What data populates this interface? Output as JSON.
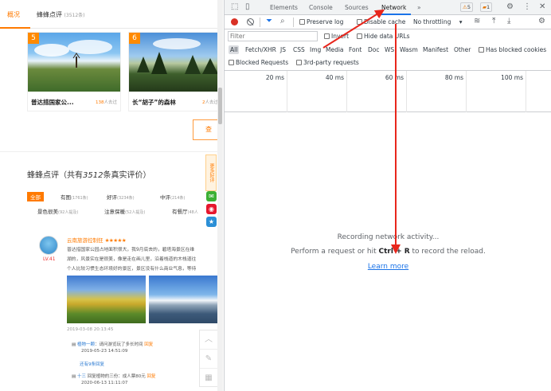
{
  "webpage": {
    "tabs": [
      {
        "label": "概况"
      },
      {
        "label": "蜂蜂点评",
        "count": "(3512条)"
      }
    ],
    "cards": [
      {
        "num": "5",
        "title": "普达措国家公...",
        "count": "138",
        "unit": "人去过"
      },
      {
        "num": "6",
        "title": "长“胡子”的森林",
        "count": "2",
        "unit": "人去过"
      }
    ],
    "more_button": "查",
    "reviews_title_prefix": "蜂蜂点评（共有",
    "reviews_count": "3512",
    "reviews_title_suffix": "条真实评价）",
    "filters": [
      {
        "label": "全部",
        "count": ""
      },
      {
        "label": "有图",
        "count": "(1761条)"
      },
      {
        "label": "好评",
        "count": "(3234条)"
      },
      {
        "label": "中评",
        "count": "(214条)"
      },
      {
        "label": "景色很美",
        "count": "(92人提及)"
      },
      {
        "label": "注意保暖",
        "count": "(52人提及)"
      },
      {
        "label": "有餐厅",
        "count": "(48人"
      }
    ],
    "side_float": "更多好评",
    "review": {
      "user": "云南旅游控制狂",
      "stars": "★★★★★",
      "level": "LV.41",
      "lines": [
        "普达措国家公园占地面积很大，我9月底去的，碧塔海景区在维",
        "湖的，风景实在是很美，像是走在画儿里，沿着栈道的木栈道往",
        "个人比较习惯生态环境好的景区，景区没有什么商业气息，等待"
      ],
      "date": "2019-03-08 20:13:45",
      "replies": [
        {
          "user": "植物一颗",
          "text": "：请问游览玩了多长时间",
          "action": "回复",
          "time": "2019-05-23 14:51:09"
        },
        {
          "user": "",
          "text": "还有9条回复",
          "action": "",
          "time": ""
        },
        {
          "user": "十三",
          "text": "回复植物的三份：成人票80元",
          "action": "回复",
          "time": "2020-06-13 11:11:07"
        }
      ]
    }
  },
  "devtools": {
    "tabs": [
      "Elements",
      "Console",
      "Sources",
      "Network",
      "»"
    ],
    "active_tab": "Network",
    "warnings": "5",
    "issues": "1",
    "toolbar": {
      "preserve_log": "Preserve log",
      "disable_cache": "Disable cache",
      "throttling": "No throttling"
    },
    "filter": {
      "placeholder": "Filter",
      "invert": "Invert",
      "hide_data_urls": "Hide data URLs",
      "types": [
        "All",
        "Fetch/XHR",
        "JS",
        "CSS",
        "Img",
        "Media",
        "Font",
        "Doc",
        "WS",
        "Wasm",
        "Manifest",
        "Other"
      ],
      "has_blocked_cookies": "Has blocked cookies",
      "blocked_requests": "Blocked Requests",
      "third_party": "3rd-party requests"
    },
    "timeline_ticks": [
      "20 ms",
      "40 ms",
      "60 ms",
      "80 ms",
      "100 ms"
    ],
    "empty": {
      "line1": "Recording network activity...",
      "line2_prefix": "Perform a request or hit ",
      "line2_shortcut": "Ctrl + R",
      "line2_suffix": " to record the reload.",
      "learn_more": "Learn more"
    }
  },
  "colors": {
    "accent_orange": "#ff7a00",
    "devtools_blue": "#1a73e8",
    "annotation_red": "#e8261c"
  }
}
